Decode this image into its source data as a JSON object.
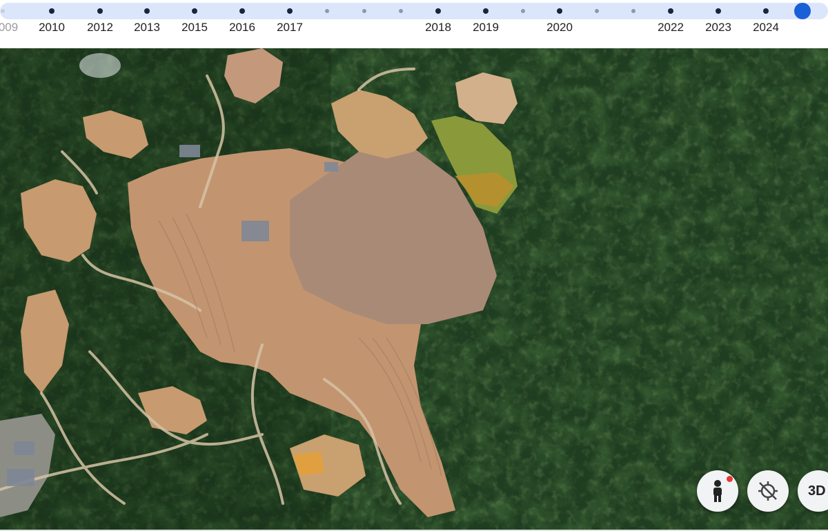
{
  "timeline": {
    "years": [
      "009",
      "2010",
      "2012",
      "2013",
      "2015",
      "2016",
      "2017",
      "2018",
      "2019",
      "2020",
      "2022",
      "2023",
      "2024"
    ],
    "selected_year": "2024"
  },
  "controls": {
    "street_view": {
      "icon": "pegman-icon"
    },
    "compass": {
      "icon": "location-disabled-icon"
    },
    "tilt": {
      "label": "3D"
    }
  },
  "colors": {
    "timeline_track": "#dce6fb",
    "selected_marker": "#1a5fd6",
    "forest": "#1f3d20",
    "bare_ground": "#c79a6f",
    "pond": "#8a9a3a"
  }
}
